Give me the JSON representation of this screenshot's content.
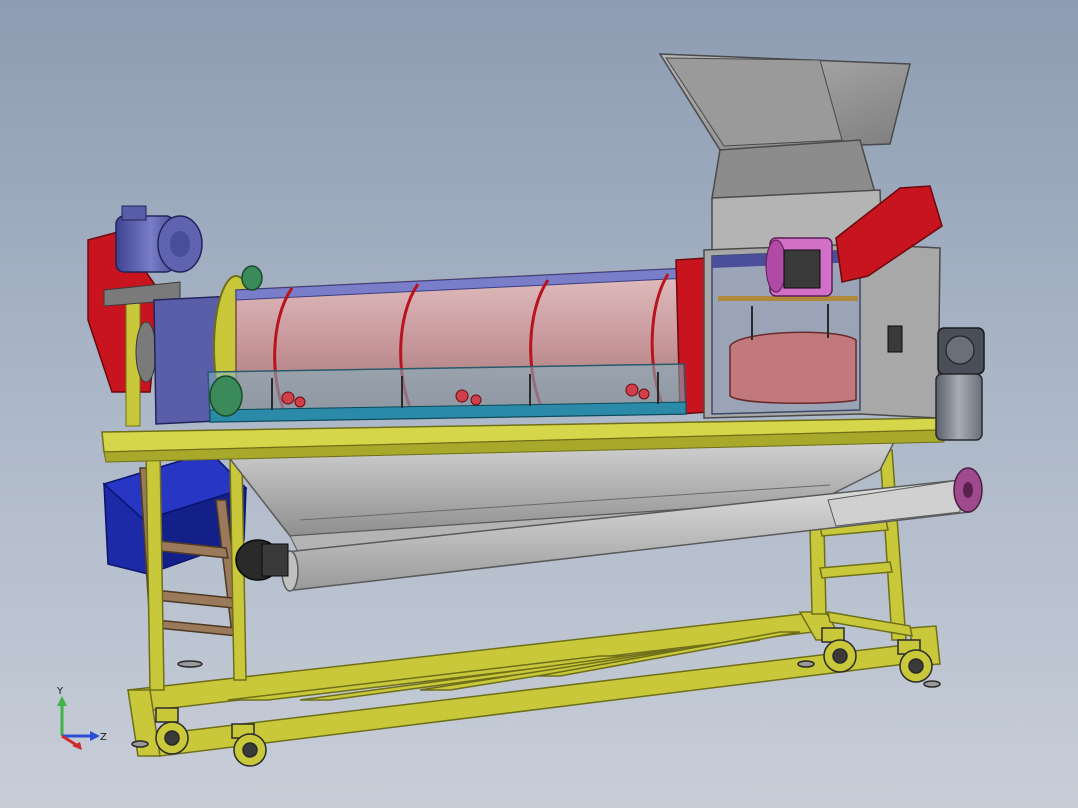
{
  "viewport": {
    "background_top": "#8d9cb2",
    "background_bottom": "#c8ced8"
  },
  "triad": {
    "y_label": "Y",
    "z_label": "Z",
    "y_color": "#3fb24a",
    "z_color": "#2a4fd6",
    "x_color": "#d22b2b"
  },
  "colors": {
    "frame_yellow": "#c8c83a",
    "motor_red": "#c8141e",
    "motor_blue": "#5a5ea8",
    "hopper_gray": "#9a9a9a",
    "drum_pink": "#c99a9c",
    "chute_blue": "#1c2aa8",
    "ladder_brown": "#9a7a5a",
    "auger_magenta": "#a04a8e",
    "trough_cyan": "#2a8aa8"
  }
}
